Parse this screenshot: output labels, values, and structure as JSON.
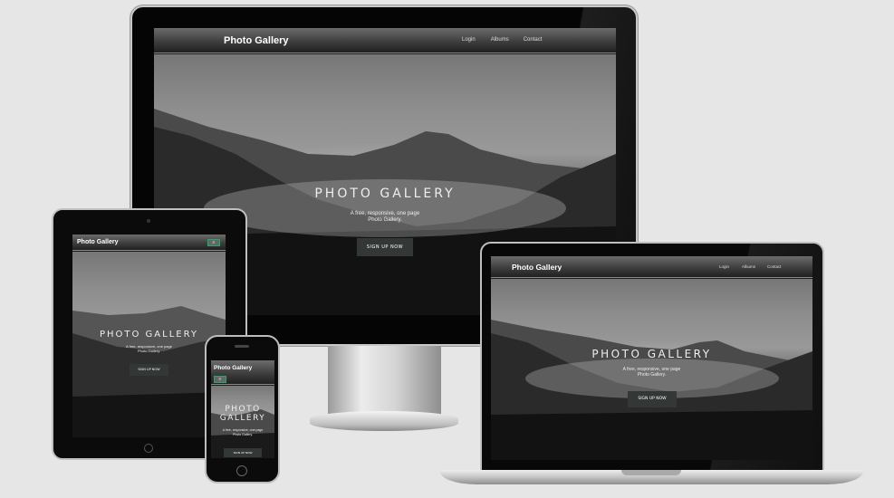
{
  "desktop": {
    "brand": "Photo Gallery",
    "nav_items": [
      "Login",
      "Albums",
      "Contact"
    ],
    "hero_title": "PHOTO GALLERY",
    "hero_subtitle_line1": "A free, responsive, one page",
    "hero_subtitle_line2": "Photo Gallery.",
    "cta_label": "SIGN UP NOW"
  },
  "laptop": {
    "brand": "Photo Gallery",
    "nav_items": [
      "Login",
      "Albums",
      "Contact"
    ],
    "hero_title": "PHOTO GALLERY",
    "hero_subtitle_line1": "A free, responsive, one page",
    "hero_subtitle_line2": "Photo Gallery.",
    "cta_label": "SIGN UP NOW"
  },
  "tablet": {
    "brand": "Photo Gallery",
    "hero_title": "PHOTO GALLERY",
    "hero_subtitle_line1": "A free, responsive, one page",
    "hero_subtitle_line2": "Photo Gallery.",
    "cta_label": "SIGN UP NOW"
  },
  "phone": {
    "brand": "Photo Gallery",
    "hero_title_line1": "PHOTO",
    "hero_title_line2": "GALLERY",
    "hero_subtitle_line1": "A free, responsive, one page",
    "hero_subtitle_line2": "Photo Gallery.",
    "cta_label": "SIGN UP NOW"
  }
}
